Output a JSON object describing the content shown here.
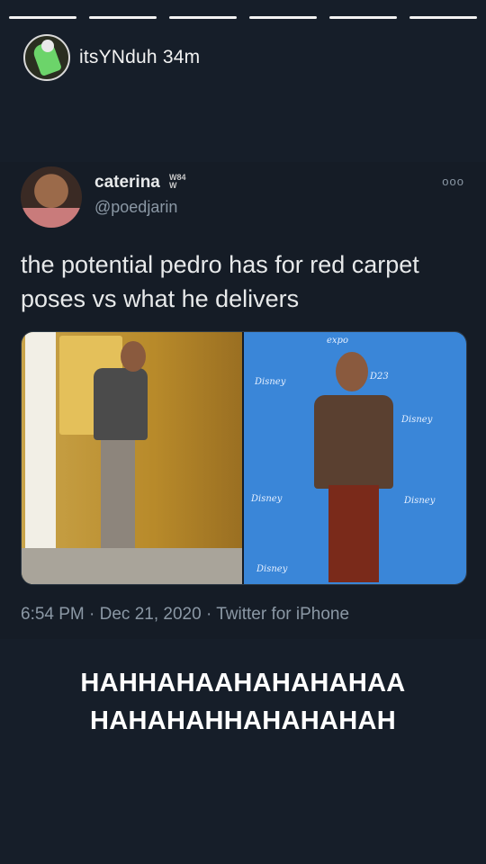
{
  "story": {
    "username": "itsYNduh",
    "time_ago": "34m",
    "progress_segments": 6
  },
  "tweet": {
    "name": "caterina",
    "badge_top": "W84",
    "badge_bottom": "W",
    "handle": "@poedjarin",
    "more": "ooo",
    "text": "the potential pedro has for red carpet poses vs what he delivers",
    "media_labels": [
      "Disney",
      "expo",
      "D23"
    ],
    "timestamp": "6:54 PM · Dec 21, 2020",
    "source": "Twitter for iPhone"
  },
  "caption": {
    "line1": "HAHHAHAAHAHAHAHAA",
    "line2": "HAHAHAHHAHAHAHAH"
  },
  "colors": {
    "background": "#161e29",
    "tweet_text": "#e7e9ea",
    "meta_text": "#8b98a5",
    "media_blue": "#3a86d8"
  }
}
